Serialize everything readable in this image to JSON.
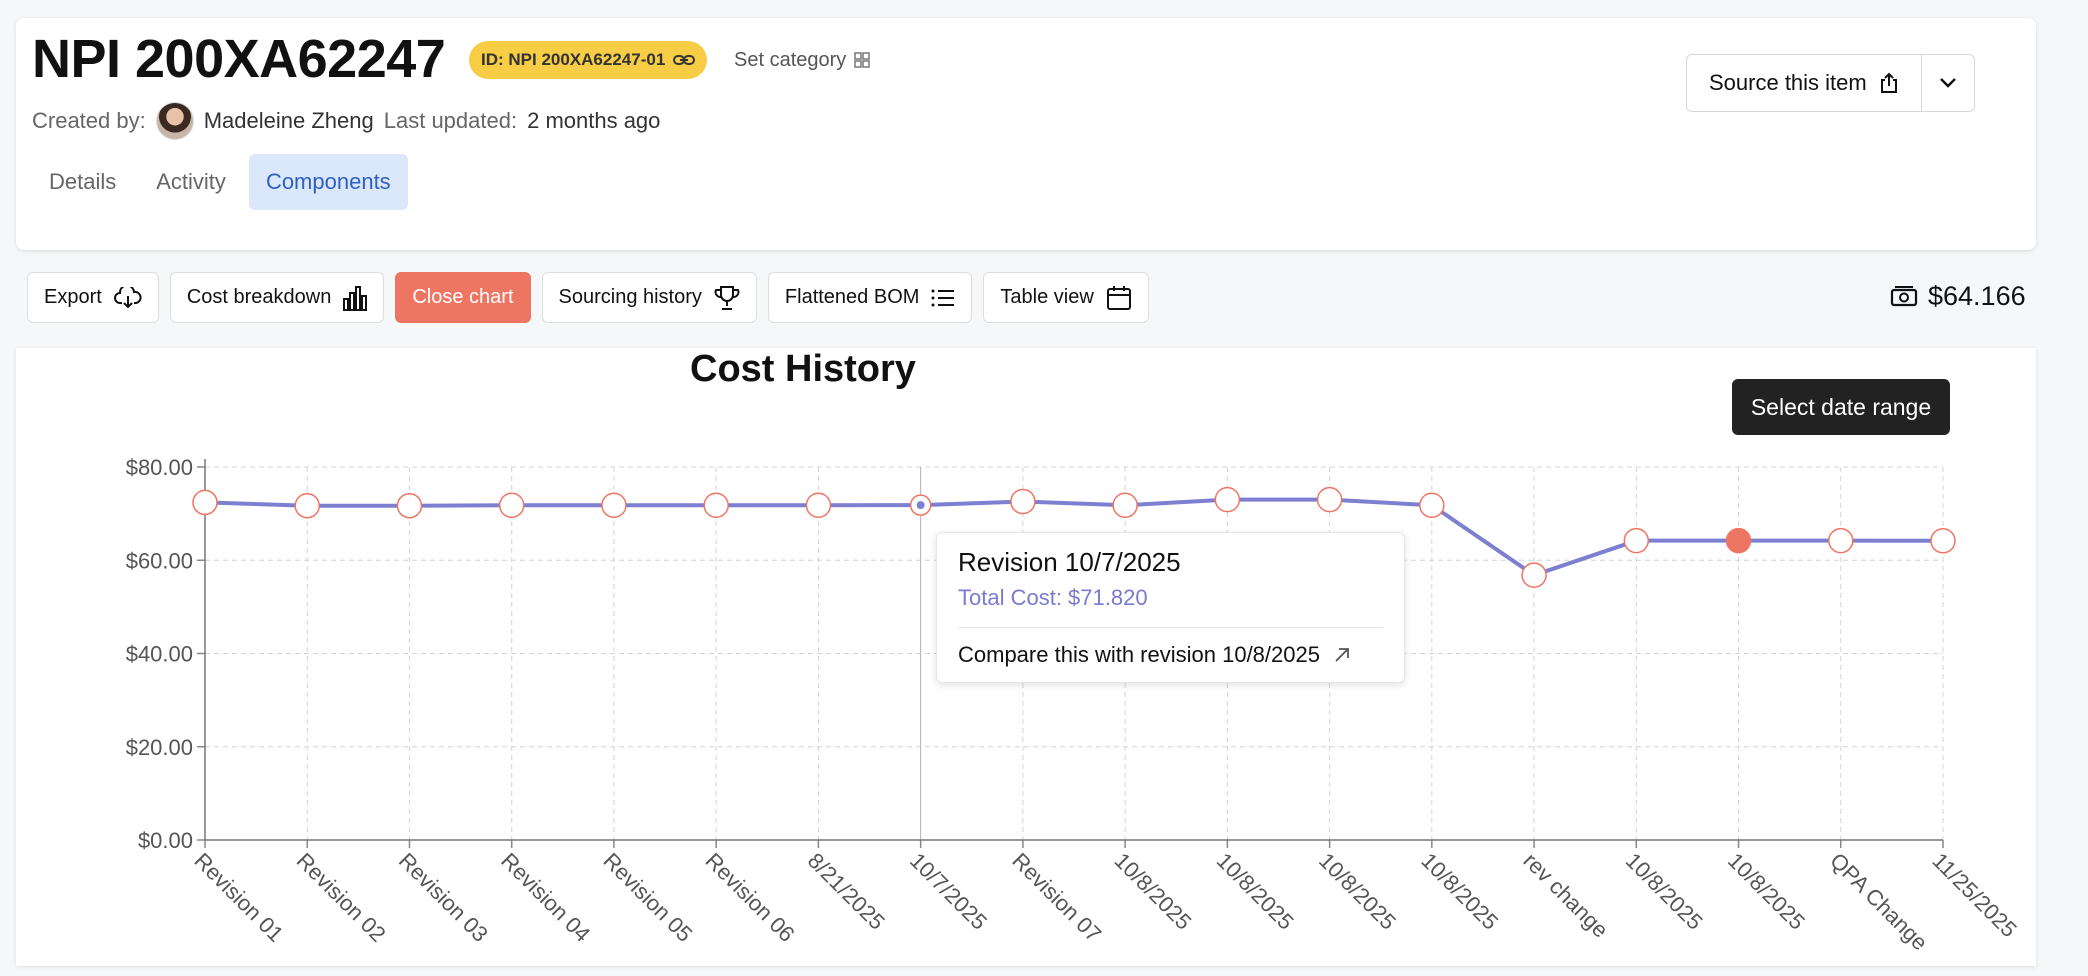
{
  "header": {
    "title": "NPI 200XA62247",
    "id_badge": "ID: NPI 200XA62247-01",
    "set_category": "Set category",
    "created_label": "Created by:",
    "created_by": "Madeleine Zheng",
    "updated_label": "Last updated:",
    "updated_value": "2 months ago",
    "source_button": "Source this item"
  },
  "tabs": [
    {
      "label": "Details",
      "active": false
    },
    {
      "label": "Activity",
      "active": false
    },
    {
      "label": "Components",
      "active": true
    }
  ],
  "toolbar": {
    "export": "Export",
    "cost_breakdown": "Cost breakdown",
    "close_chart": "Close chart",
    "sourcing_history": "Sourcing history",
    "flattened_bom": "Flattened BOM",
    "table_view": "Table view",
    "total_cost": "$64.166"
  },
  "select_date_range": "Select date range",
  "tooltip": {
    "title": "Revision 10/7/2025",
    "cost": "Total Cost: $71.820",
    "compare": "Compare this with revision 10/8/2025"
  },
  "colors": {
    "accent": "#ef7563",
    "line": "#7d7fd1",
    "badge": "#f7cd45",
    "tab_active_bg": "#dbe7fb",
    "tab_active_text": "#2f5fc4"
  },
  "chart_data": {
    "type": "line",
    "title": "Cost History",
    "xlabel": "",
    "ylabel": "",
    "ylim": [
      0,
      80
    ],
    "yticks": [
      "$0.00",
      "$20.00",
      "$40.00",
      "$60.00",
      "$80.00"
    ],
    "grid": true,
    "categories": [
      "Revision 01",
      "Revision 02",
      "Revision 03",
      "Revision 04",
      "Revision 05",
      "Revision 06",
      "8/21/2025",
      "10/7/2025",
      "Revision 07",
      "10/8/2025",
      "10/8/2025",
      "10/8/2025",
      "10/8/2025",
      "rev change",
      "10/8/2025",
      "10/8/2025",
      "QPA Change",
      "11/25/2025"
    ],
    "series": [
      {
        "values": [
          72.4,
          71.7,
          71.7,
          71.8,
          71.8,
          71.8,
          71.8,
          71.82,
          72.6,
          71.8,
          73.0,
          73.0,
          71.8,
          56.8,
          64.2,
          64.2,
          64.2,
          64.17
        ]
      }
    ],
    "hovered_index": 7,
    "selected_index": 15
  }
}
